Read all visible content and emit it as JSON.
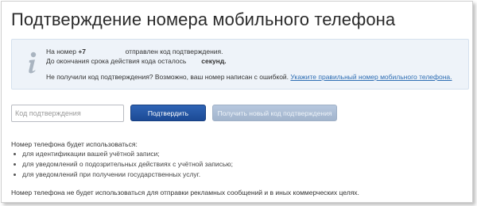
{
  "page": {
    "title": "Подтверждение номера мобильного телефона"
  },
  "info": {
    "line1_prefix": "На номер",
    "phone_prefix": "+7",
    "line1_suffix": "отправлен код подтверждения.",
    "line2_prefix": "До окончания срока действия кода осталось",
    "line2_suffix": "секунд.",
    "line3_text": "Не получили код подтверждения? Возможно, ваш номер написан с ошибкой.",
    "line3_link": "Укажите правильный номер мобильного телефона."
  },
  "form": {
    "code_placeholder": "Код подтверждения",
    "code_value": "",
    "confirm_label": "Подтвердить",
    "resend_label": "Получить новый код подтверждения"
  },
  "usage": {
    "title": "Номер телефона будет использоваться:",
    "items": [
      "для идентификации вашей учётной записи;",
      "для уведомлений о подозрительных действиях с учётной записью;",
      "для уведомлений при получении государственных услуг."
    ]
  },
  "note": "Номер телефона не будет использоваться для отправки рекламных сообщений и в иных коммерческих целях.",
  "colors": {
    "accent": "#1f4f9c",
    "link": "#2d6db3",
    "info_bg": "#eef3f9",
    "disabled_button": "#aabbd2"
  },
  "icons": {
    "info": "info-icon"
  }
}
